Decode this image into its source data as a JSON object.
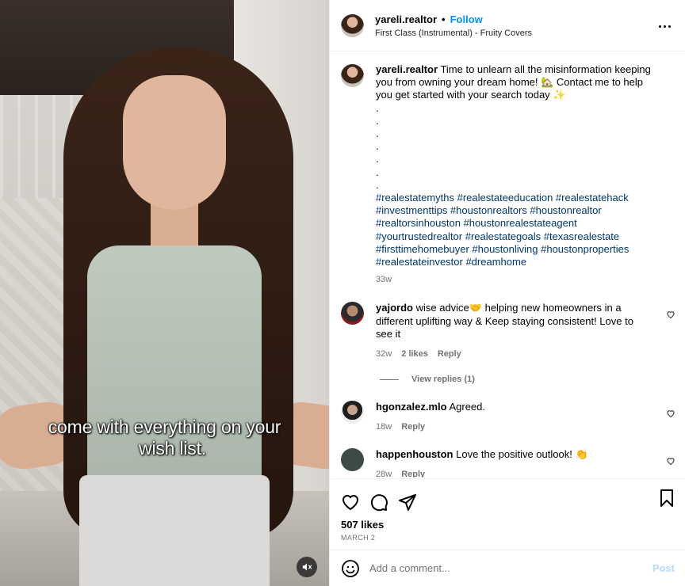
{
  "video": {
    "caption_line1": "come with everything on your",
    "caption_line2": "wish list.",
    "mute_icon": "speaker-muted-icon"
  },
  "header": {
    "username": "yareli.realtor",
    "separator": "•",
    "follow_label": "Follow",
    "song": "First Class (Instrumental) - Fruity Covers",
    "more_icon": "more-options-icon"
  },
  "post_caption": {
    "username": "yareli.realtor",
    "text": "Time to unlearn all the misinformation keeping you from owning your dream home! 🏡 Contact me to help you get started with your search today ✨",
    "dots": [
      ".",
      ".",
      ".",
      ".",
      ".",
      ".",
      "."
    ],
    "hashtags": "#realestatemyths #realestateeducation #realestatehack #investmenttips #houstonrealtors #houstonrealtor #realtorsinhouston #houstonrealestateagent #yourtrustedrealtor #realestategoals #texasrealestate #firsttimehomebuyer #houstonliving #houstonproperties #realestateinvestor #dreamhome",
    "time": "33w"
  },
  "comments": [
    {
      "username": "yajordo",
      "text": "wise advice🤝 helping new homeowners in a different uplifting way & Keep staying consistent! Love to see it",
      "time": "32w",
      "likes": "2 likes",
      "reply": "Reply",
      "view_replies": "View replies (1)"
    },
    {
      "username": "hgonzalez.mlo",
      "text": "Agreed.",
      "time": "18w",
      "reply": "Reply"
    },
    {
      "username": "happenhouston",
      "text": "Love the positive outlook! 👏",
      "time": "28w",
      "reply": "Reply"
    }
  ],
  "actions": {
    "like_icon": "heart-icon",
    "comment_icon": "comment-icon",
    "share_icon": "share-icon",
    "save_icon": "bookmark-icon",
    "likes": "507 likes",
    "date": "MARCH 2"
  },
  "add_comment": {
    "emoji_icon": "emoji-icon",
    "placeholder": "Add a comment...",
    "post_label": "Post"
  },
  "colors": {
    "accent": "#0095f6",
    "hashtag": "#00376b",
    "muted": "#737373",
    "post_disabled": "#b3dbff"
  }
}
